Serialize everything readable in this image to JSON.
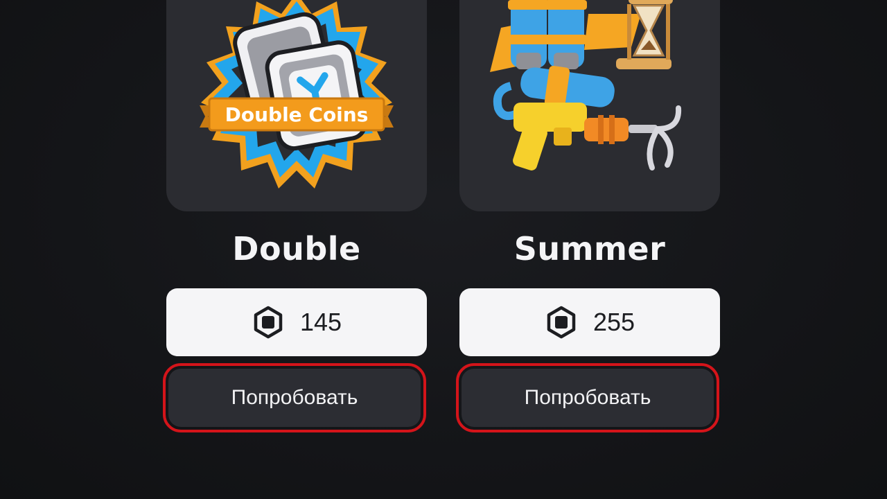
{
  "items": [
    {
      "title": "Double",
      "price": "145",
      "button_label": "Попробовать",
      "image_text": "Double Coins",
      "icon": "double-coins-badge"
    },
    {
      "title": "Summer",
      "price": "255",
      "button_label": "Попробовать",
      "icon": "summer-gear-bundle"
    }
  ],
  "currency_icon": "robux-icon",
  "colors": {
    "background": "#131417",
    "card": "#2b2c31",
    "price_bg": "#f5f5f7",
    "button_bg": "#2c2d33",
    "highlight": "#d4141a"
  }
}
